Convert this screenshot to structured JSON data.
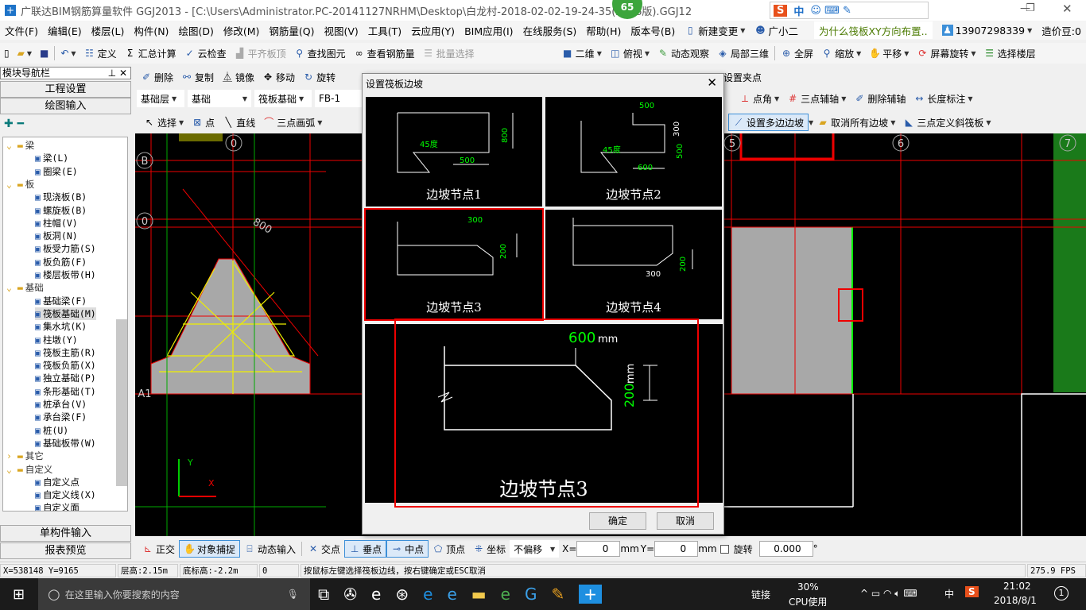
{
  "titlebar": {
    "title": "广联达BIM钢筋算量软件 GGJ2013 - [C:\\Users\\Administrator.PC-20141127NRHM\\Desktop\\白龙村-2018-02-02-19-24-35(2666版).GGJ12",
    "badge": "65"
  },
  "ime": {
    "logo": "S",
    "mode": "中"
  },
  "menu": [
    "文件(F)",
    "编辑(E)",
    "楼层(L)",
    "构件(N)",
    "绘图(D)",
    "修改(M)",
    "钢筋量(Q)",
    "视图(V)",
    "工具(T)",
    "云应用(Y)",
    "BIM应用(I)",
    "在线服务(S)",
    "帮助(H)",
    "版本号(B)",
    "新建变更",
    "广小二"
  ],
  "menu_right": {
    "notice": "为什么筏板XY方向布置..",
    "phone": "13907298339",
    "beans": "造价豆:0"
  },
  "toolbar1": [
    "定义",
    "汇总计算",
    "云检查",
    "平齐板顶",
    "查找图元",
    "查看钢筋量",
    "批量选择",
    "二维",
    "俯视",
    "动态观察",
    "局部三维",
    "全屏",
    "缩放",
    "平移",
    "屏幕旋转",
    "选择楼层"
  ],
  "toolbar2": [
    "删除",
    "复制",
    "镜像",
    "移动",
    "旋转",
    "设置夹点"
  ],
  "toolbar3": {
    "floor": "基础层",
    "type": "基础",
    "comp": "筏板基础",
    "name": "FB-1",
    "right": [
      "点角",
      "三点辅轴",
      "删除辅轴",
      "长度标注"
    ]
  },
  "toolbar4": {
    "left": [
      "选择",
      "点",
      "直线",
      "三点画弧"
    ],
    "right": [
      "设置多边边坡",
      "取消所有边坡",
      "三点定义斜筏板"
    ]
  },
  "sidebar": {
    "title": "模块导航栏",
    "btn1": "工程设置",
    "btn2": "绘图输入",
    "btn3": "单构件输入",
    "btn4": "报表预览",
    "tree": [
      {
        "t": "梁",
        "f": 1
      },
      {
        "t": "梁(L)"
      },
      {
        "t": "圈梁(E)"
      },
      {
        "t": "板",
        "f": 1
      },
      {
        "t": "现浇板(B)"
      },
      {
        "t": "螺旋板(B)"
      },
      {
        "t": "柱帽(V)"
      },
      {
        "t": "板洞(N)"
      },
      {
        "t": "板受力筋(S)"
      },
      {
        "t": "板负筋(F)"
      },
      {
        "t": "楼层板带(H)"
      },
      {
        "t": "基础",
        "f": 1
      },
      {
        "t": "基础梁(F)"
      },
      {
        "t": "筏板基础(M)",
        "sel": 1
      },
      {
        "t": "集水坑(K)"
      },
      {
        "t": "柱墩(Y)"
      },
      {
        "t": "筏板主筋(R)"
      },
      {
        "t": "筏板负筋(X)"
      },
      {
        "t": "独立基础(P)"
      },
      {
        "t": "条形基础(T)"
      },
      {
        "t": "桩承台(V)"
      },
      {
        "t": "承台梁(F)"
      },
      {
        "t": "桩(U)"
      },
      {
        "t": "基础板带(W)"
      },
      {
        "t": "其它",
        "f": 1
      },
      {
        "t": "自定义",
        "f": 1
      },
      {
        "t": "自定义点"
      },
      {
        "t": "自定义线(X)"
      },
      {
        "t": "自定义面"
      }
    ]
  },
  "canvas": {
    "axes": [
      "B",
      "0",
      "A1",
      "5",
      "6",
      "7"
    ],
    "dim": "800",
    "y": "Y",
    "x": "X"
  },
  "dialog": {
    "title": "设置筏板边坡",
    "nodes": [
      {
        "label": "边坡节点1",
        "d1": "800",
        "d2": "500",
        "ang": "45度"
      },
      {
        "label": "边坡节点2",
        "d1": "500",
        "d2": "300",
        "d3": "500",
        "d4": "600",
        "ang": "45度"
      },
      {
        "label": "边坡节点3",
        "d1": "300",
        "d2": "200"
      },
      {
        "label": "边坡节点4",
        "d1": "200",
        "d2": "300"
      }
    ],
    "selected": 2,
    "preview": {
      "label": "边坡节点3",
      "w": "600",
      "h": "200",
      "unit": "mm"
    },
    "ok": "确定",
    "cancel": "取消"
  },
  "bottombar": {
    "items": [
      "正交",
      "对象捕捉",
      "动态输入",
      "交点",
      "垂点",
      "中点",
      "顶点",
      "坐标"
    ],
    "offset": "不偏移",
    "x_label": "X=",
    "x": "0",
    "y_label": "Y=",
    "y": "0",
    "unit": "mm",
    "rotate": "旋转",
    "rotate_val": "0.000",
    "deg": "°"
  },
  "status": {
    "coords": "X=538148 Y=9165",
    "floor_h": "层高:2.15m",
    "bottom": "底标高:-2.2m",
    "num": "0",
    "hint": "按鼠标左键选择筏板边线，按右键确定或ESC取消",
    "fps": "275.9 FPS"
  },
  "taskbar": {
    "search": "在这里输入你要搜索的内容",
    "link": "链接",
    "cpu": "30%",
    "cpu_label": "CPU使用",
    "ime": "中",
    "time": "21:02",
    "date": "2018/8/1",
    "notif": "1"
  }
}
